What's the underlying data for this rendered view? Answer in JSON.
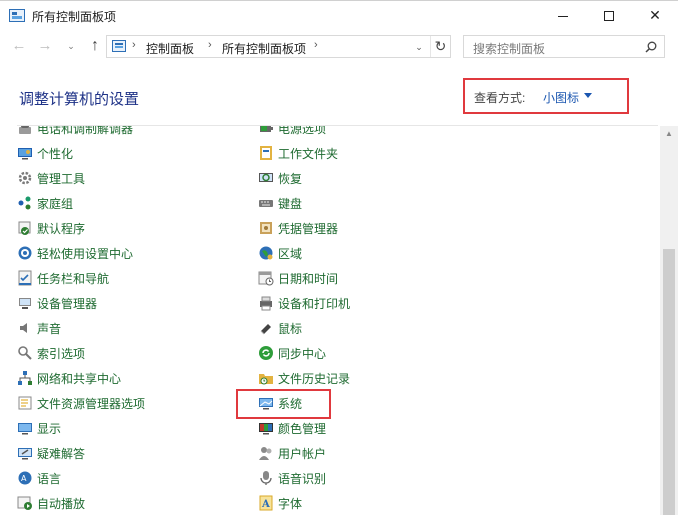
{
  "window": {
    "title": "所有控制面板项",
    "controls": {
      "minimize": "minimize",
      "maximize": "maximize",
      "close": "✕"
    }
  },
  "nav": {
    "back": "←",
    "forward": "→",
    "recent": "⌄",
    "up": "↑",
    "breadcrumb": [
      "控制面板",
      "所有控制面板项"
    ],
    "separator": "›",
    "dropdown": "⌄",
    "refresh": "↻",
    "search_placeholder": "搜索控制面板"
  },
  "header": {
    "title": "调整计算机的设置",
    "view_label": "查看方式:",
    "view_value": "小图标"
  },
  "items": {
    "left": [
      {
        "label": "电话和调制解调器",
        "icon": "phone-modem-icon",
        "color": "#555"
      },
      {
        "label": "个性化",
        "icon": "personalization-icon",
        "color": "#1f5fb0"
      },
      {
        "label": "管理工具",
        "icon": "admin-tools-icon",
        "color": "#7a7a7a"
      },
      {
        "label": "家庭组",
        "icon": "homegroup-icon",
        "color": "#1a9a6b"
      },
      {
        "label": "默认程序",
        "icon": "default-programs-icon",
        "color": "#2e7d32"
      },
      {
        "label": "轻松使用设置中心",
        "icon": "ease-of-access-icon",
        "color": "#2d6fb6"
      },
      {
        "label": "任务栏和导航",
        "icon": "taskbar-icon",
        "color": "#2d6fb6"
      },
      {
        "label": "设备管理器",
        "icon": "device-manager-icon",
        "color": "#555"
      },
      {
        "label": "声音",
        "icon": "sound-icon",
        "color": "#666"
      },
      {
        "label": "索引选项",
        "icon": "indexing-icon",
        "color": "#666"
      },
      {
        "label": "网络和共享中心",
        "icon": "network-icon",
        "color": "#2d6fb6"
      },
      {
        "label": "文件资源管理器选项",
        "icon": "folder-options-icon",
        "color": "#e3b341"
      },
      {
        "label": "显示",
        "icon": "display-icon",
        "color": "#2d6fb6"
      },
      {
        "label": "疑难解答",
        "icon": "troubleshoot-icon",
        "color": "#2d6fb6"
      },
      {
        "label": "语言",
        "icon": "language-icon",
        "color": "#2d6fb6"
      },
      {
        "label": "自动播放",
        "icon": "autoplay-icon",
        "color": "#2e7d32"
      }
    ],
    "right": [
      {
        "label": "电源选项",
        "icon": "power-options-icon",
        "color": "#555"
      },
      {
        "label": "工作文件夹",
        "icon": "work-folders-icon",
        "color": "#2d6fb6"
      },
      {
        "label": "恢复",
        "icon": "recovery-icon",
        "color": "#2e7d32"
      },
      {
        "label": "键盘",
        "icon": "keyboard-icon",
        "color": "#555"
      },
      {
        "label": "凭据管理器",
        "icon": "credential-manager-icon",
        "color": "#a07a3a"
      },
      {
        "label": "区域",
        "icon": "region-icon",
        "color": "#2d6fb6"
      },
      {
        "label": "日期和时间",
        "icon": "date-time-icon",
        "color": "#777"
      },
      {
        "label": "设备和打印机",
        "icon": "devices-printers-icon",
        "color": "#555"
      },
      {
        "label": "鼠标",
        "icon": "mouse-icon",
        "color": "#444"
      },
      {
        "label": "同步中心",
        "icon": "sync-center-icon",
        "color": "#2e9d3a"
      },
      {
        "label": "文件历史记录",
        "icon": "file-history-icon",
        "color": "#d9a92a"
      },
      {
        "label": "系统",
        "icon": "system-icon",
        "color": "#2d6fb6"
      },
      {
        "label": "颜色管理",
        "icon": "color-management-icon",
        "color": "#c0392b"
      },
      {
        "label": "用户帐户",
        "icon": "user-accounts-icon",
        "color": "#777"
      },
      {
        "label": "语音识别",
        "icon": "speech-recognition-icon",
        "color": "#777"
      },
      {
        "label": "字体",
        "icon": "fonts-icon",
        "color": "#e3b341"
      }
    ]
  }
}
